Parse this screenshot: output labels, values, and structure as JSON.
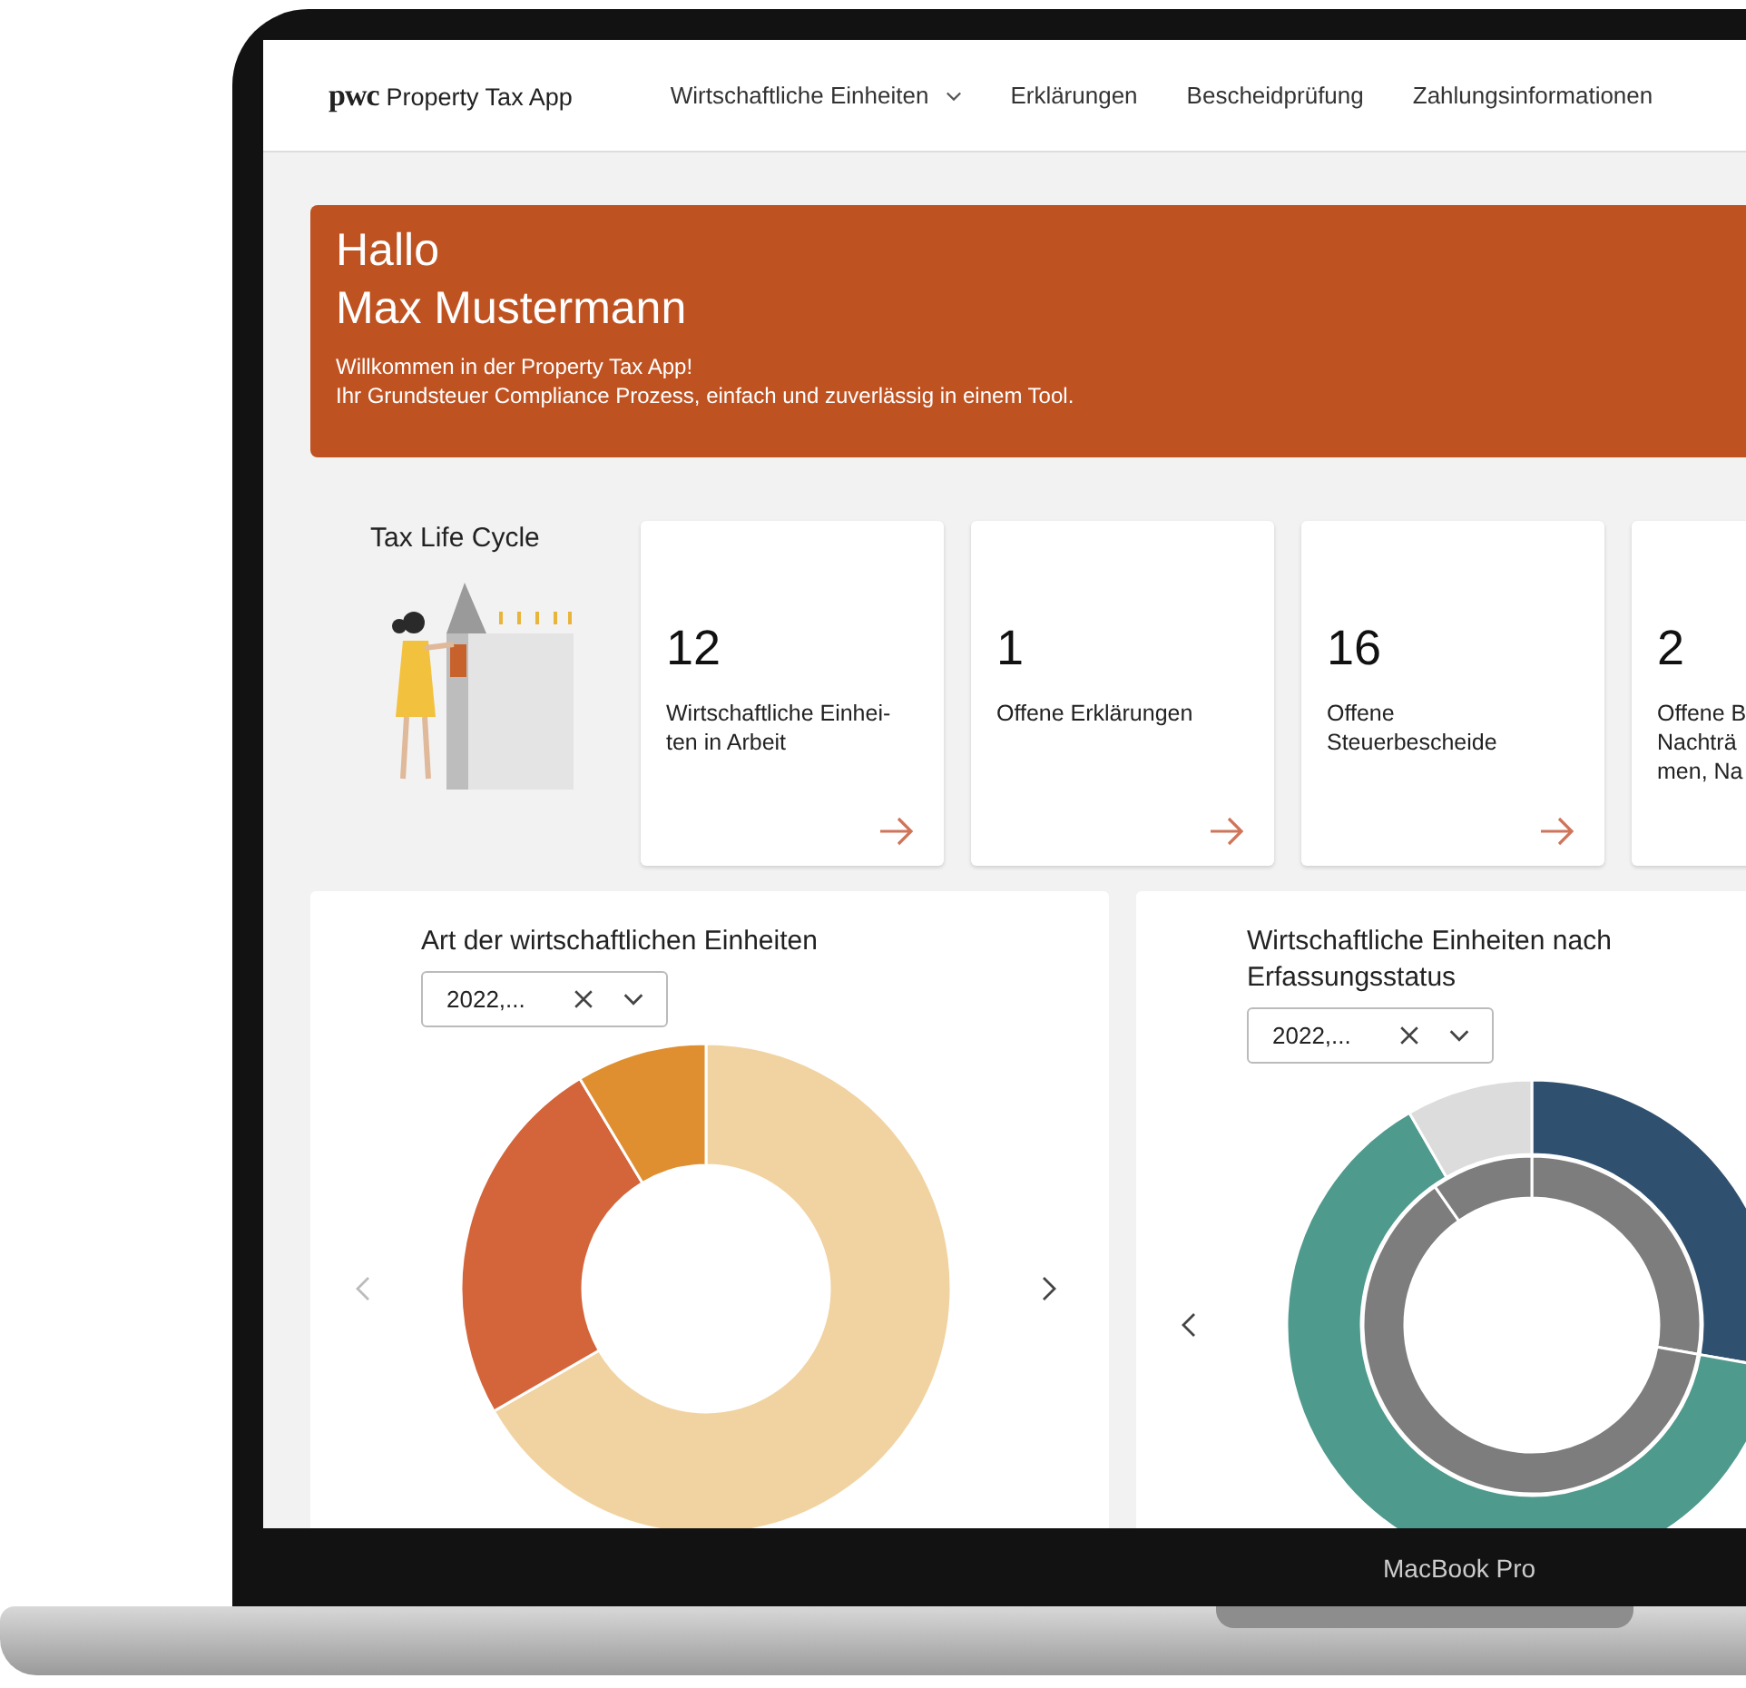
{
  "app": {
    "logo": "pwc",
    "name": "Property Tax App"
  },
  "nav": [
    {
      "label": "Wirtschaftliche Einheiten",
      "kind": "dropdown"
    },
    {
      "label": "Erklärungen",
      "kind": "link"
    },
    {
      "label": "Bescheidprüfung",
      "kind": "link"
    },
    {
      "label": "Zahlungsinformationen",
      "kind": "link"
    }
  ],
  "banner": {
    "greeting": "Hallo",
    "name": "Max Mustermann",
    "lines": [
      "Willkommen in der Property Tax App!",
      "Ihr Grundsteuer Compliance Prozess, einfach und zuverlässig in einem Tool."
    ]
  },
  "tax_life_cycle": {
    "title": "Tax Life Cycle"
  },
  "cards": [
    {
      "count": "12",
      "lines": [
        "Wirtschaftliche Einhei-",
        "ten in Arbeit"
      ]
    },
    {
      "count": "1",
      "lines": [
        "Offene Erklärungen"
      ]
    },
    {
      "count": "16",
      "lines": [
        "Offene",
        "Steuerbescheide"
      ]
    },
    {
      "count": "2",
      "lines": [
        "Offene B",
        "Nachträ",
        "men, Na"
      ]
    }
  ],
  "charts": [
    {
      "title": "Art der wirtschaftlichen Einheiten",
      "filter": "2022,...",
      "kind": "single"
    },
    {
      "title": "Wirtschaftliche Einheiten nach Erfassungsstatus",
      "filter": "2022,...",
      "kind": "double"
    }
  ],
  "device": {
    "label": "MacBook Pro"
  }
}
